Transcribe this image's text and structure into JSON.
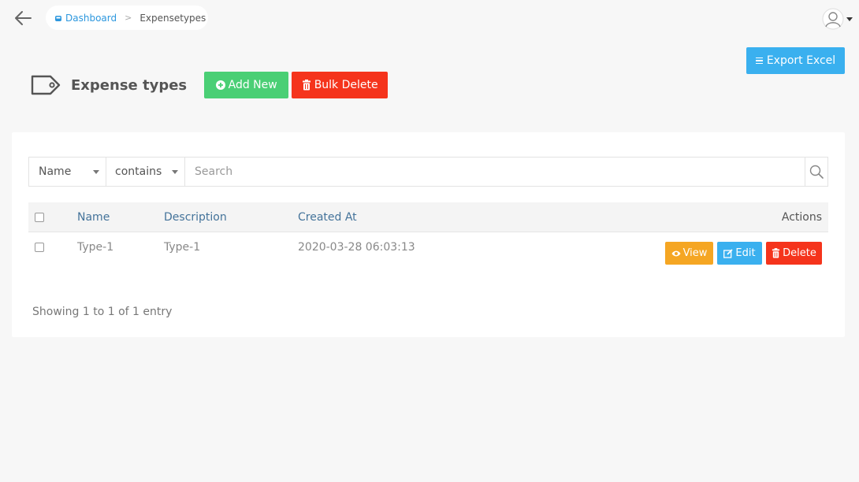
{
  "breadcrumb": {
    "home_label": "Dashboard",
    "current_label": "Expensetypes"
  },
  "header": {
    "title": "Expense types",
    "add_label": "Add New",
    "bulk_delete_label": "Bulk Delete",
    "export_label": "Export Excel"
  },
  "filter": {
    "field_value": "Name",
    "operator_value": "contains",
    "search_placeholder": "Search",
    "search_value": ""
  },
  "table": {
    "columns": [
      "Name",
      "Description",
      "Created At",
      "Actions"
    ],
    "rows": [
      {
        "name": "Type-1",
        "description": "Type-1",
        "created_at": "2020-03-28 06:03:13"
      }
    ],
    "actions": {
      "view": "View",
      "edit": "Edit",
      "delete": "Delete"
    }
  },
  "footer": {
    "entries_text": "Showing 1 to 1 of 1 entry"
  },
  "colors": {
    "background": "#f7f7f7",
    "primary": "#3ab0ef",
    "success": "#4acf75",
    "danger": "#f5341c",
    "warning": "#f5a623",
    "link": "#2c97de",
    "column_header": "#44739a"
  },
  "icons": {
    "back": "arrow-left-icon",
    "home": "home-icon",
    "user": "user-avatar-icon",
    "export": "list-icon",
    "page": "tag-icon",
    "add": "plus-circle-icon",
    "bulk_delete": "trash-icon",
    "search": "search-icon",
    "view": "eye-icon",
    "edit": "edit-icon",
    "delete": "trash-icon"
  }
}
